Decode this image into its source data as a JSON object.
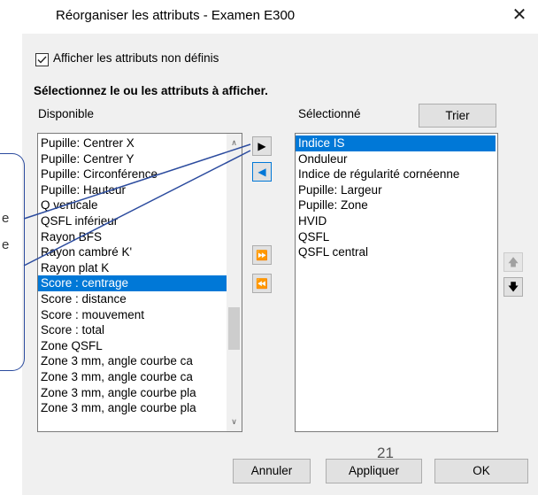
{
  "window": {
    "title": "Réorganiser les attributs - Examen E300",
    "close_glyph": "✕"
  },
  "show_undefined": {
    "label": "Afficher les attributs non définis",
    "checked": true
  },
  "instruction": "Sélectionnez le ou les attributs à afficher.",
  "available": {
    "header": "Disponible",
    "items": [
      "Pupille: Centrer X",
      "Pupille: Centrer Y",
      "Pupille: Circonférence",
      "Pupille: Hauteur",
      "Q verticale",
      "QSFL inférieur",
      "Rayon BFS",
      "Rayon cambré K'",
      "Rayon plat K",
      "Score : centrage",
      "Score : distance",
      "Score : mouvement",
      "Score : total",
      "Zone QSFL",
      "Zone 3 mm, angle courbe ca",
      "Zone 3 mm, angle courbe ca",
      "Zone 3 mm, angle courbe pla",
      "Zone 3 mm, angle courbe pla"
    ],
    "selected_index": 9
  },
  "selected": {
    "header": "Sélectionné",
    "sort_button": "Trier",
    "items": [
      "Indice IS",
      "Onduleur",
      "Indice de régularité cornéenne",
      "Pupille: Largeur",
      "Pupille: Zone",
      "HVID",
      "QSFL",
      "QSFL central"
    ],
    "selected_index": 0
  },
  "transfer_buttons": {
    "move_right": "▶",
    "move_left": "◀",
    "move_all_right": "⏩",
    "move_all_left": "⏪"
  },
  "order_buttons": {
    "up": "🡅",
    "down": "🡇"
  },
  "footer": {
    "cancel": "Annuler",
    "apply": "Appliquer",
    "ok": "OK"
  },
  "overlay": {
    "page_number": "21",
    "fragment_e1": "e",
    "fragment_e2": "e"
  },
  "colors": {
    "selection": "#0078d7",
    "annotation": "#2b4b9e"
  }
}
